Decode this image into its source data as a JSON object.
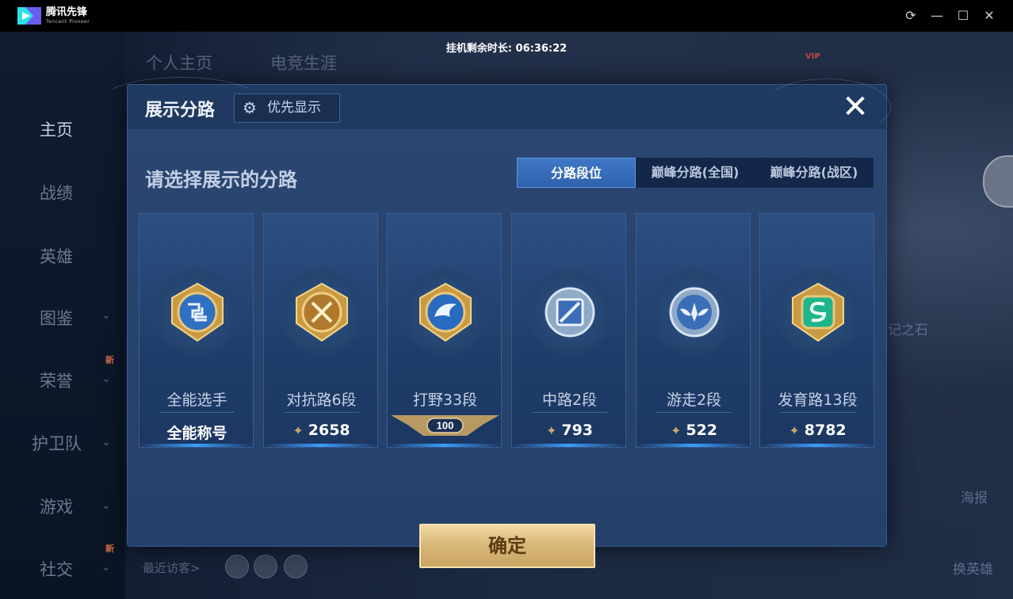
{
  "window": {
    "app_name": "腾讯先锋",
    "app_subtitle": "Tencent Pioneer",
    "controls": {
      "refresh": "⟳",
      "minimize": "—",
      "maximize": "☐",
      "close": "✕"
    },
    "idle_timer": "挂机剩余时长: 06:36:22"
  },
  "background": {
    "nav_items": [
      {
        "label": "主页",
        "active": true
      },
      {
        "label": "战绩"
      },
      {
        "label": "英雄"
      },
      {
        "label": "图鉴"
      },
      {
        "label": "荣誉"
      },
      {
        "label": "护卫队"
      },
      {
        "label": "游戏"
      },
      {
        "label": "社交"
      }
    ],
    "new_badge": "新",
    "top_tabs": [
      "个人主页",
      "电竞生涯"
    ],
    "vip": "VIP",
    "right_texts": [
      "记之石",
      "海报",
      "换英雄"
    ],
    "visitors_label": "最近访客>"
  },
  "dialog": {
    "title": "展示分路",
    "priority_button": "优先显示",
    "close": "✕",
    "subtitle": "请选择展示的分路",
    "tabs": [
      {
        "label": "分路段位",
        "active": true
      },
      {
        "label": "巅峰分路(全国)"
      },
      {
        "label": "巅峰分路(战区)"
      }
    ],
    "cards": [
      {
        "name": "全能选手",
        "footer": "全能称号",
        "points": "",
        "emblem": "all-round-emblem",
        "color": "#3f86d8"
      },
      {
        "name": "对抗路6段",
        "footer": "",
        "points": "2658",
        "emblem": "clash-lane-emblem",
        "color": "#d9a548"
      },
      {
        "name": "打野33段",
        "footer": "",
        "points": "",
        "badge": "100",
        "emblem": "jungle-emblem",
        "color": "#2f7ad4"
      },
      {
        "name": "中路2段",
        "footer": "",
        "points": "793",
        "emblem": "mid-lane-emblem",
        "color": "#7aa6d6"
      },
      {
        "name": "游走2段",
        "footer": "",
        "points": "522",
        "emblem": "roam-emblem",
        "color": "#8fb4df"
      },
      {
        "name": "发育路13段",
        "footer": "",
        "points": "8782",
        "emblem": "farm-lane-emblem",
        "color": "#2ec79a"
      }
    ],
    "confirm": "确定"
  },
  "colors": {
    "accent": "#3f78c6",
    "gold": "#d8b677",
    "dialog_bg": "#213a62"
  }
}
